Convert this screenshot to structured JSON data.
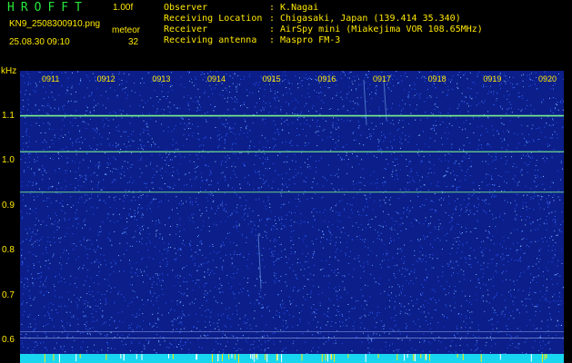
{
  "header": {
    "app_title": "HROFFT",
    "version": "1.00f",
    "filename": "KN9_2508300910.png",
    "mode": "meteor",
    "datetime": "25.08.30 09:10",
    "count": "32"
  },
  "info": [
    {
      "key": "Observer",
      "value": ": K.Nagai"
    },
    {
      "key": "Receiving Location",
      "value": ": Chigasaki, Japan (139.414 35.340)"
    },
    {
      "key": "Receiver",
      "value": ": AirSpy mini (Miakejima VOR 108.65MHz)"
    },
    {
      "key": "Receiving antenna",
      "value": ": Maspro FM-3"
    }
  ],
  "spectrogram": {
    "y_unit": "kHz",
    "x_ticks": [
      "0911",
      "0912",
      "0913",
      "0914",
      "0915",
      "0916",
      "0917",
      "0918",
      "0919",
      "0920"
    ],
    "y_ticks": [
      "1.1",
      "1.0",
      "0.9",
      "0.8",
      "0.7",
      "0.6"
    ],
    "y_range": [
      0.57,
      1.2
    ],
    "colors": {
      "background": "#0b1e8a",
      "noise": "#2a58ff",
      "carrier": "#7dff8a",
      "axis_text": "#ffe800",
      "bottom_bar": "#18d6f0"
    },
    "carriers_khz": [
      1.1,
      1.02,
      0.93
    ]
  }
}
